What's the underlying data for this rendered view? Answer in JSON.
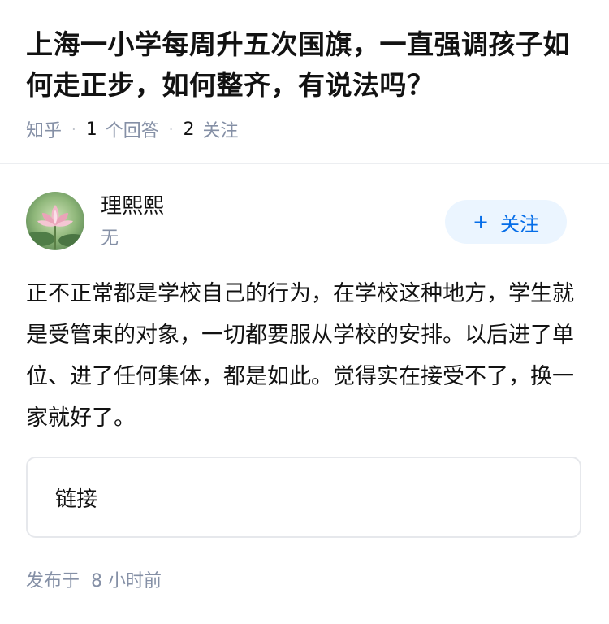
{
  "question": {
    "title": "上海一小学每周升五次国旗，一直强调孩子如何走正步，如何整齐，有说法吗？",
    "source": "知乎",
    "answer_count": "1",
    "answer_label": "个回答",
    "follower_count": "2",
    "follower_label": "关注"
  },
  "author": {
    "name": "理熙熙",
    "bio": "无",
    "avatar_icon": "lotus-flower-avatar",
    "follow_plus": "+",
    "follow_label": "关注"
  },
  "answer": {
    "text": "正不正常都是学校自己的行为，在学校这种地方，学生就是受管束的对象，一切都要服从学校的安排。以后进了单位、进了任何集体，都是如此。觉得实在接受不了，换一家就好了。"
  },
  "link_card": {
    "label": "链接"
  },
  "footer": {
    "published_prefix": "发布于",
    "published_time": "8 小时前"
  },
  "colors": {
    "accent": "#056de8",
    "button_bg": "#ebf5ff",
    "muted": "#8590a6"
  }
}
